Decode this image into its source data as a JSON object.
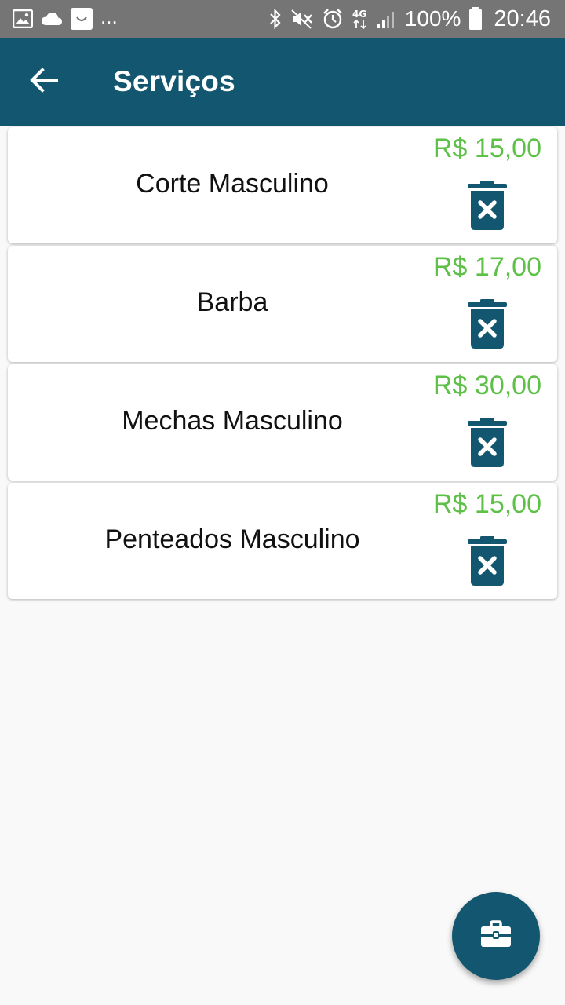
{
  "status_bar": {
    "left_icons": [
      "image-icon",
      "cloud-icon",
      "smile-icon"
    ],
    "overflow": "...",
    "right_icons": [
      "bluetooth-icon",
      "mute-icon",
      "alarm-icon",
      "4g-signal-icon",
      "signal-bars-icon"
    ],
    "battery": "100%",
    "time": "20:46"
  },
  "app_bar": {
    "back_icon": "arrow-left-icon",
    "title": "Serviços"
  },
  "services": [
    {
      "name": "Corte Masculino",
      "price": "R$ 15,00",
      "delete_icon": "trash-x-icon"
    },
    {
      "name": "Barba",
      "price": "R$ 17,00",
      "delete_icon": "trash-x-icon"
    },
    {
      "name": "Mechas Masculino",
      "price": "R$ 30,00",
      "delete_icon": "trash-x-icon"
    },
    {
      "name": "Penteados Masculino",
      "price": "R$ 15,00",
      "delete_icon": "trash-x-icon"
    }
  ],
  "fab": {
    "icon": "briefcase-icon"
  },
  "colors": {
    "primary": "#12566f",
    "price": "#5dc047",
    "status_bar": "#757575",
    "background": "#f9f9f9"
  }
}
